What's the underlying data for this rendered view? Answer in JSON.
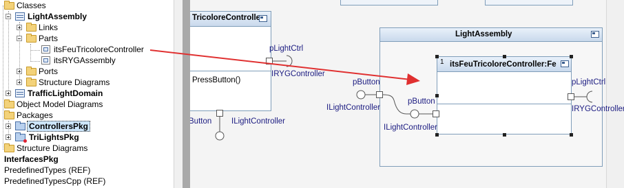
{
  "tree": {
    "classes": "Classes",
    "light_assembly": "LightAssembly",
    "links": "Links",
    "parts": "Parts",
    "part_feu": "itsFeuTricoloreController",
    "part_ryg": "itsRYGAssembly",
    "ports": "Ports",
    "structure_diagrams_inner": "Structure Diagrams",
    "traffic_light_domain": "TrafficLightDomain",
    "object_model_diagrams": "Object Model Diagrams",
    "packages": "Packages",
    "controllers_pkg": "ControllersPkg",
    "trilights_pkg": "TriLightsPkg",
    "structure_diagrams": "Structure Diagrams",
    "interfaces_pkg": "InterfacesPkg",
    "predefined_types": "PredefinedTypes (REF)",
    "predefined_types_cpp": "PredefinedTypesCpp (REF)"
  },
  "diagram": {
    "left_class_title": "TricoloreControlle",
    "left_operation": "PressButton()",
    "left_port_label": "pLightCtrl",
    "left_interface_label": "IRYGController",
    "left_bottom_port_label": "Button",
    "left_bottom_interface_label": "ILightController",
    "assembly_title": "LightAssembly",
    "part_multiplicity": "1",
    "part_title": "itsFeuTricoloreController:Fe",
    "outer_port_label": "pButton",
    "outer_interface_label": "ILightController",
    "inner_port_label": "pButton",
    "inner_interface_label": "ILightController",
    "right_port_label": "pLightCtrl",
    "right_interface_label": "IRYGController"
  },
  "colors": {
    "arrow": "#e03030",
    "label_blue": "#1a1a80",
    "selection_fill": "#cde6fb"
  },
  "icons": [
    "expand-icon",
    "collapse-icon",
    "folder-icon",
    "class-icon",
    "part-icon",
    "package-icon",
    "structure-diagram-icon"
  ]
}
